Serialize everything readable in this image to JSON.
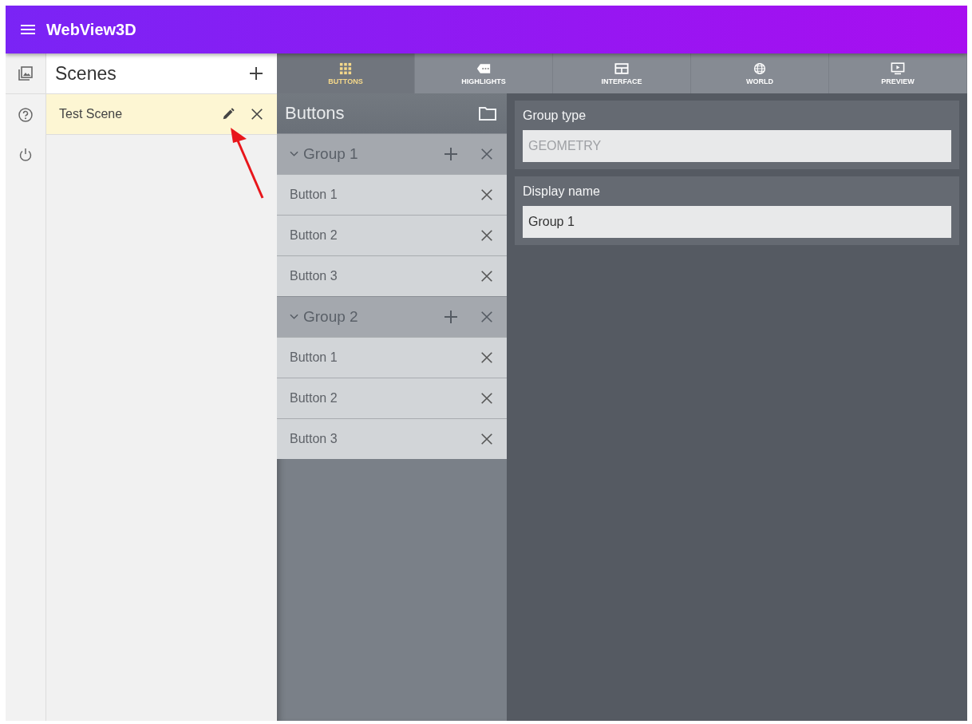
{
  "app_bar": {
    "title": "WebView3D"
  },
  "scenes": {
    "title": "Scenes",
    "items": [
      {
        "name": "Test Scene",
        "selected": true
      }
    ]
  },
  "tabs": [
    {
      "label": "BUTTONS",
      "kind": "grid",
      "selected": true
    },
    {
      "label": "HIGHLIGHTS",
      "kind": "tag",
      "selected": false
    },
    {
      "label": "INTERFACE",
      "kind": "window",
      "selected": false
    },
    {
      "label": "WORLD",
      "kind": "globe",
      "selected": false
    },
    {
      "label": "PREVIEW",
      "kind": "play",
      "selected": false
    }
  ],
  "buttons_panel": {
    "title": "Buttons",
    "groups": [
      {
        "name": "Group 1",
        "expanded": true,
        "children": [
          {
            "name": "Button 1"
          },
          {
            "name": "Button 2"
          },
          {
            "name": "Button 3"
          }
        ]
      },
      {
        "name": "Group 2",
        "expanded": true,
        "children": [
          {
            "name": "Button 1"
          },
          {
            "name": "Button 2"
          },
          {
            "name": "Button 3"
          }
        ]
      }
    ]
  },
  "properties": [
    {
      "label": "Group type",
      "value": "GEOMETRY",
      "disabled": true
    },
    {
      "label": "Display name",
      "value": "Group 1",
      "disabled": false
    }
  ]
}
